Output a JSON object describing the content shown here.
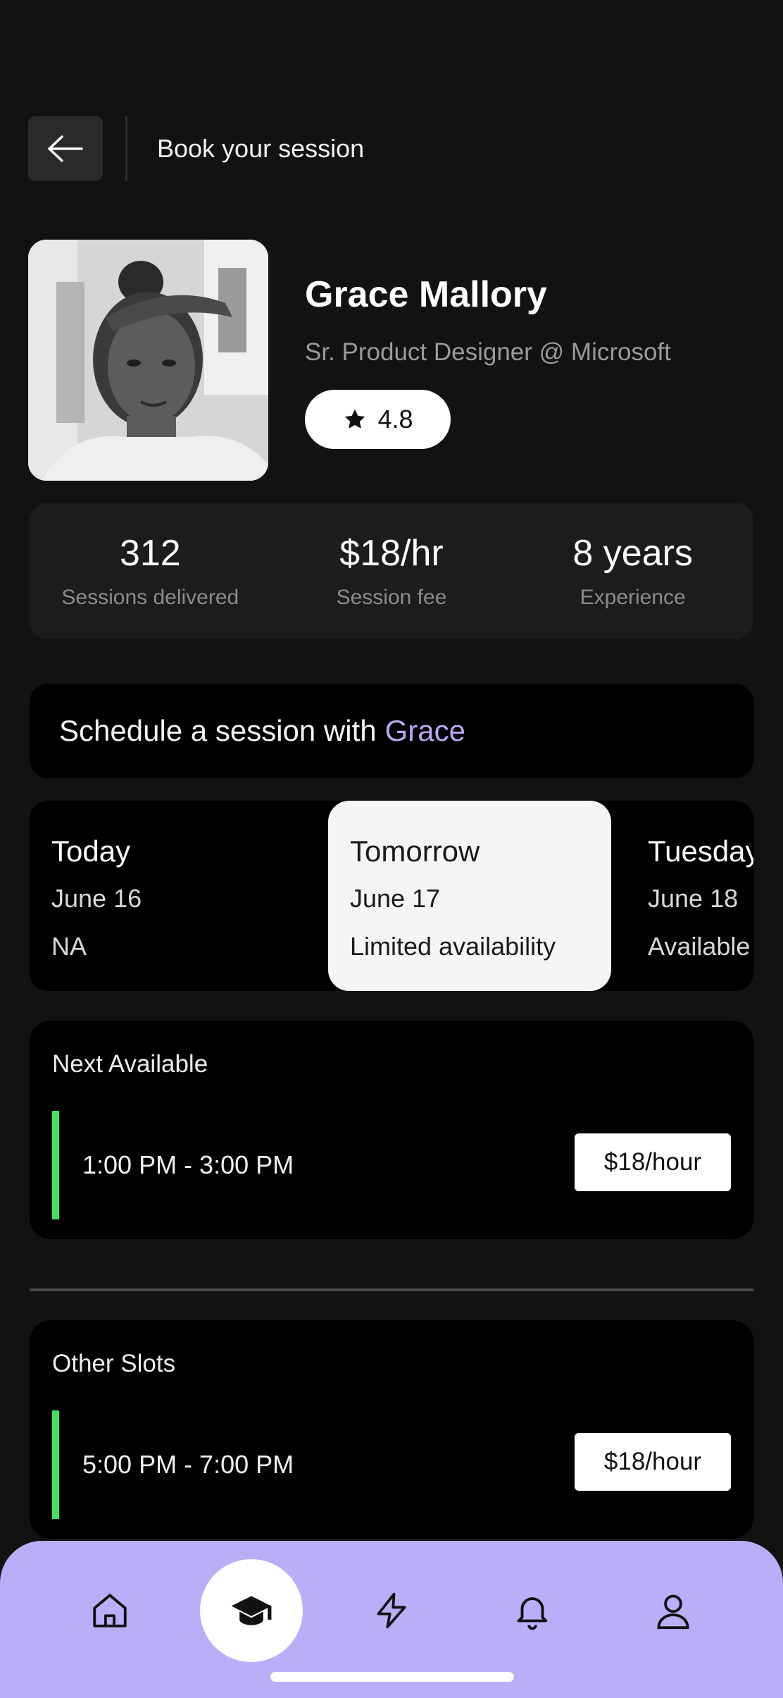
{
  "header": {
    "title": "Book your session"
  },
  "profile": {
    "name": "Grace Mallory",
    "role": "Sr. Product Designer @ Microsoft",
    "rating": "4.8"
  },
  "stats": [
    {
      "value": "312",
      "label": "Sessions delivered"
    },
    {
      "value": "$18/hr",
      "label": "Session fee"
    },
    {
      "value": "8 years",
      "label": "Experience"
    }
  ],
  "schedule": {
    "prefix": "Schedule a session with",
    "highlight": "Grace",
    "highlight_color": "#bba7f2"
  },
  "days": [
    {
      "name": "Today",
      "date": "June 16",
      "status": "NA",
      "selected": false
    },
    {
      "name": "Tomorrow",
      "date": "June 17",
      "status": "Limited availability",
      "selected": true
    },
    {
      "name": "Tuesday",
      "date": "June 18",
      "status": "Available",
      "selected": false
    }
  ],
  "next_available": {
    "title": "Next Available",
    "time": "1:00 PM - 3:00 PM",
    "price": "$18/hour"
  },
  "other_slots": {
    "title": "Other Slots",
    "time": "5:00 PM - 7:00 PM",
    "price": "$18/hour"
  },
  "nav": {
    "items": [
      "home-icon",
      "graduation-cap-icon",
      "lightning-icon",
      "bell-icon",
      "user-icon"
    ],
    "active": "graduation-cap-icon",
    "background": "#bbaef9"
  },
  "colors": {
    "accent": "#bba7f2",
    "slot_bar": "#3ee55a",
    "background": "#121212"
  }
}
